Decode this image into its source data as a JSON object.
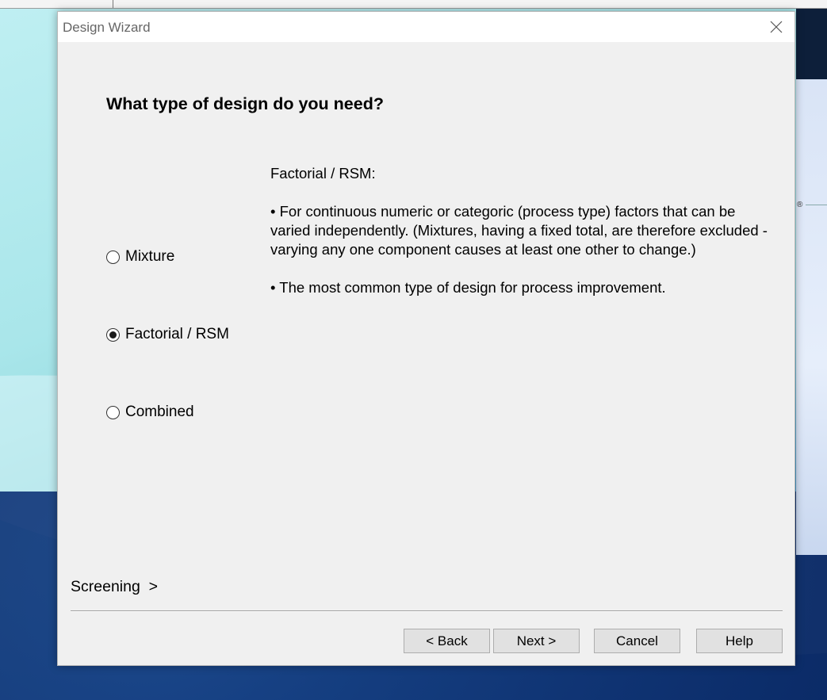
{
  "window": {
    "title": "Design Wizard"
  },
  "main": {
    "heading": "What type of design do you need?",
    "options": [
      {
        "label": "Mixture",
        "selected": false
      },
      {
        "label": "Factorial / RSM",
        "selected": true
      },
      {
        "label": "Combined",
        "selected": false
      }
    ],
    "description": {
      "title": "Factorial / RSM:",
      "bullet1": "• For continuous numeric or categoric (process type) factors that can be varied independently. (Mixtures, having a fixed total, are therefore excluded - varying any one component causes at least one other to change.)",
      "bullet2": "• The most common type of design for process improvement."
    }
  },
  "footer": {
    "screening_link": "Screening  >",
    "back_label": "< Back",
    "next_label": "Next >",
    "cancel_label": "Cancel",
    "help_label": "Help"
  },
  "desktop": {
    "mark": "®"
  },
  "icons": {
    "close": "close-icon"
  }
}
